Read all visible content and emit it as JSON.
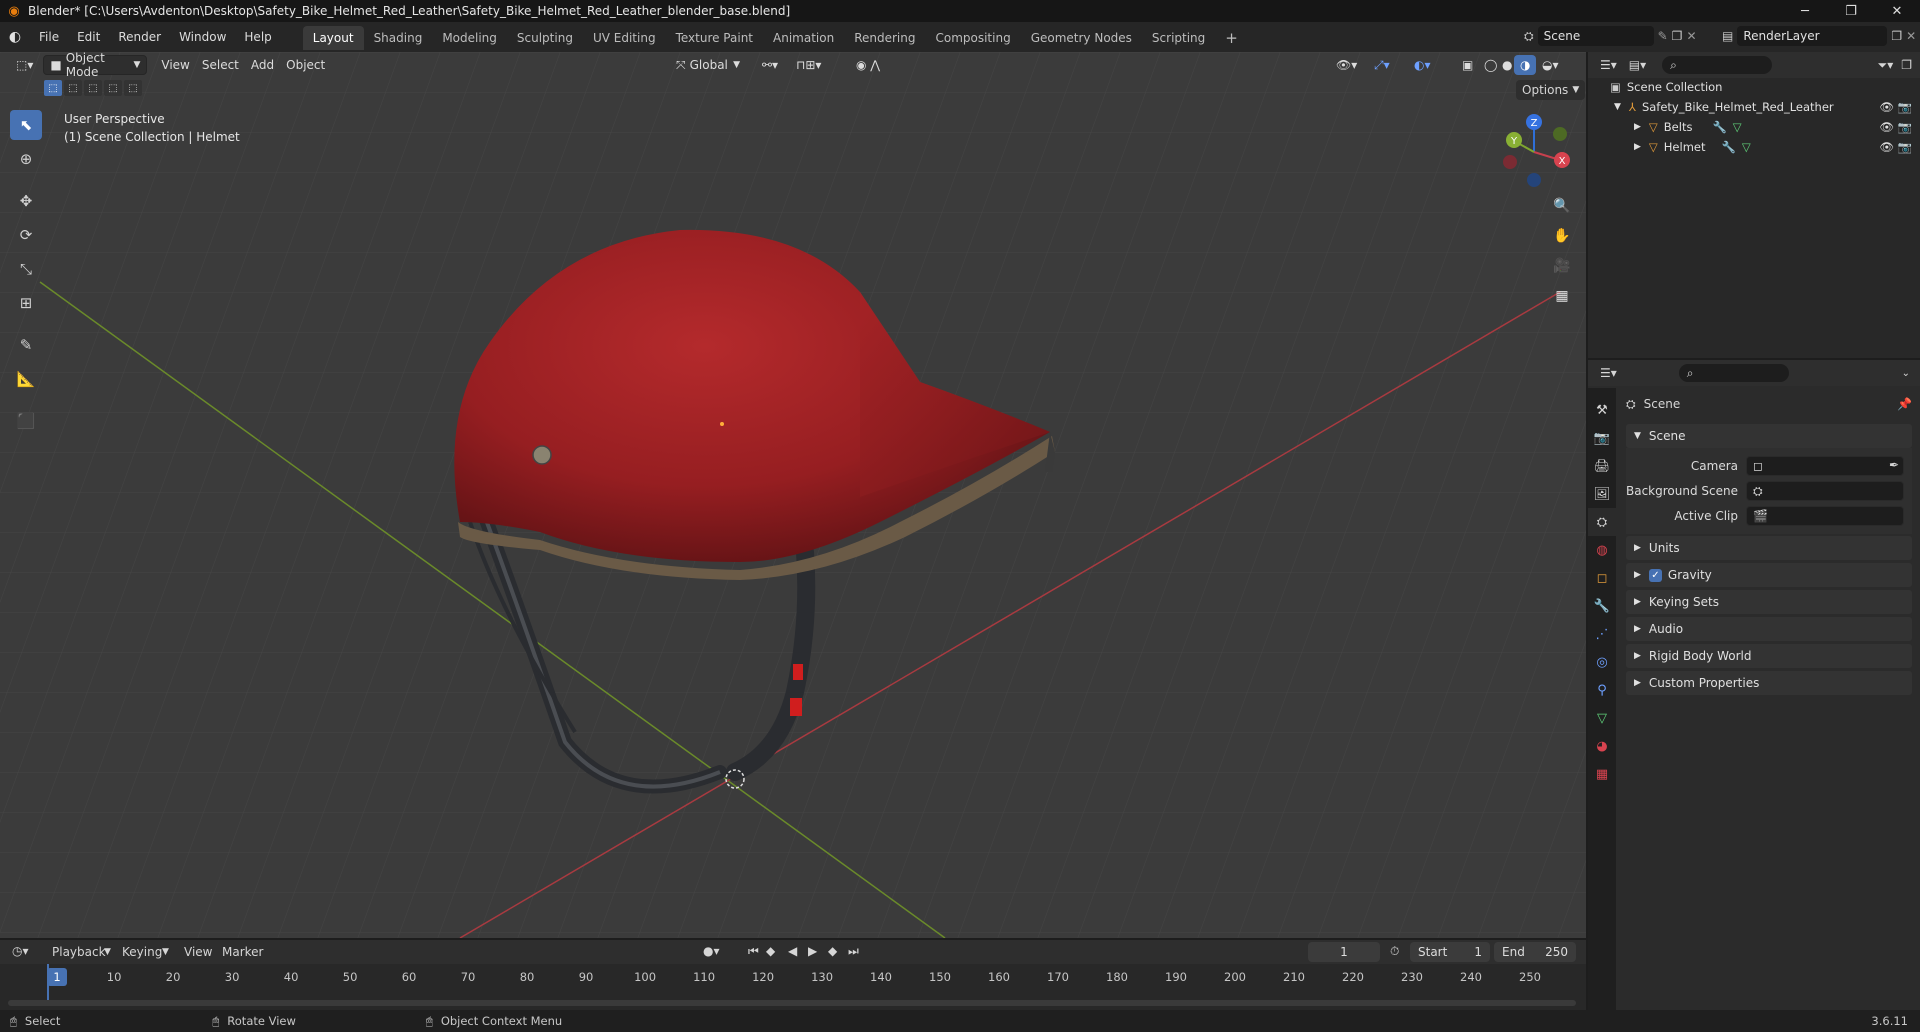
{
  "window": {
    "title": "Blender* [C:\\Users\\Avdenton\\Desktop\\Safety_Bike_Helmet_Red_Leather\\Safety_Bike_Helmet_Red_Leather_blender_base.blend]",
    "minimize": "─",
    "maximize": "❐",
    "close": "✕"
  },
  "menu": {
    "items": [
      "File",
      "Edit",
      "Render",
      "Window",
      "Help"
    ]
  },
  "workspaces": {
    "tabs": [
      "Layout",
      "Shading",
      "Modeling",
      "Sculpting",
      "UV Editing",
      "Texture Paint",
      "Animation",
      "Rendering",
      "Compositing",
      "Geometry Nodes",
      "Scripting"
    ],
    "active": "Layout",
    "add": "+"
  },
  "topright": {
    "scene": "Scene",
    "view_layer": "RenderLayer"
  },
  "viewport": {
    "mode": "Object Mode",
    "menus": [
      "View",
      "Select",
      "Add",
      "Object"
    ],
    "orientation": "Global",
    "options": "Options",
    "overlay_line1": "User Perspective",
    "overlay_line2": "(1) Scene Collection | Helmet",
    "gizmo": {
      "x": "X",
      "y": "Y",
      "z": "Z"
    }
  },
  "outliner": {
    "root": "Scene Collection",
    "collection": "Safety_Bike_Helmet_Red_Leather",
    "objects": [
      "Belts",
      "Helmet"
    ]
  },
  "properties": {
    "context": "Scene",
    "panel": "Scene",
    "camera_label": "Camera",
    "background_label": "Background Scene",
    "clip_label": "Active Clip",
    "sections": [
      "Units",
      "Gravity",
      "Keying Sets",
      "Audio",
      "Rigid Body World",
      "Custom Properties"
    ],
    "gravity_checked": true
  },
  "timeline": {
    "menus": [
      "Playback",
      "Keying",
      "View",
      "Marker"
    ],
    "current_frame": "1",
    "start_label": "Start",
    "start": "1",
    "end_label": "End",
    "end": "250",
    "ticks": [
      "1",
      "10",
      "20",
      "30",
      "40",
      "50",
      "60",
      "70",
      "80",
      "90",
      "100",
      "110",
      "120",
      "130",
      "140",
      "150",
      "160",
      "170",
      "180",
      "190",
      "200",
      "210",
      "220",
      "230",
      "240",
      "250"
    ]
  },
  "status": {
    "select": "Select",
    "rotate": "Rotate View",
    "context_menu": "Object Context Menu",
    "version": "3.6.11"
  },
  "colors": {
    "accent": "#4772b3",
    "x_axis": "#c6404d",
    "y_axis": "#7fa62f",
    "helmet_red": "#9e1f22"
  }
}
